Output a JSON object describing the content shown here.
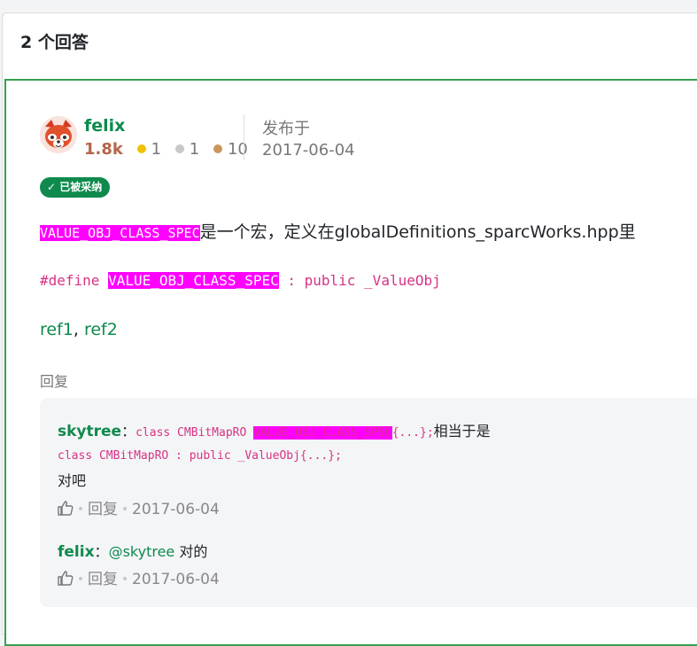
{
  "header": {
    "title": "2 个回答"
  },
  "answer": {
    "author": "felix",
    "reputation": "1.8k",
    "badges": [
      {
        "color": "#f2c200",
        "count": "1"
      },
      {
        "color": "#c8c8c8",
        "count": "1"
      },
      {
        "color": "#c9965c",
        "count": "10"
      }
    ],
    "posted_label": "发布于",
    "posted_date": "2017-06-04",
    "accepted_label": "✓ 已被采纳",
    "body": {
      "macro": "VALUE_OBJ_CLASS_SPEC",
      "text": "是一个宏，定义在globalDefinitions_sparcWorks.hpp里",
      "code_prefix": "#define ",
      "code_suffix": " : public _ValueObj",
      "refs": [
        {
          "label": "ref1"
        },
        {
          "label": "ref2"
        }
      ],
      "refs_separator": ", "
    },
    "reply_link": "回复"
  },
  "comments": [
    {
      "author": "skytree",
      "colon": "：",
      "code1": "class CMBitMapRO ",
      "macro": "VALUE_OBJ_CLASS_SPEC",
      "code2": "{...};",
      "text1": "相当于是",
      "code3": "class CMBitMapRO : public _ValueObj{...};",
      "text2": "对吧",
      "reply": "回复",
      "date": "2017-06-04"
    },
    {
      "author": "felix",
      "colon": "：",
      "mention": "@skytree",
      "text": " 对的",
      "reply": "回复",
      "date": "2017-06-04"
    }
  ],
  "colors": {
    "accent": "#0e8a4d",
    "highlight": "#ff00ff",
    "code": "#d63384"
  },
  "icons": {
    "like": "thumbs-up-icon"
  }
}
